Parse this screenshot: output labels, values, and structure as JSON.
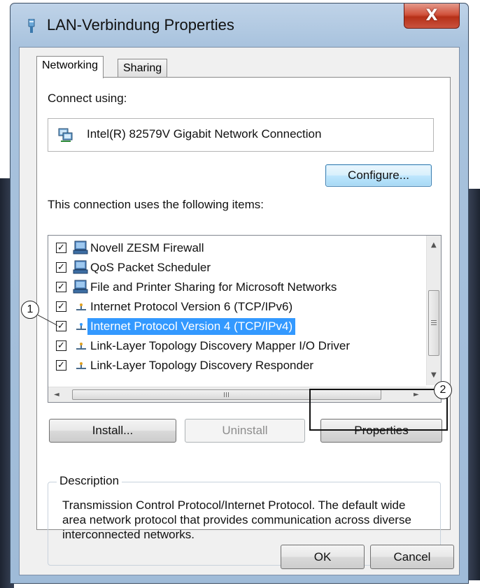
{
  "window": {
    "title": "LAN-Verbindung Properties",
    "close_glyph": "X"
  },
  "tabs": [
    {
      "label": "Networking",
      "active": true
    },
    {
      "label": "Sharing",
      "active": false
    }
  ],
  "connect_using": {
    "label": "Connect using:",
    "adapter": "Intel(R) 82579V Gigabit Network Connection",
    "adapter_icon": "network-adapter-icon",
    "configure_label": "Configure..."
  },
  "items_label": "This connection uses the following items:",
  "items": [
    {
      "label": "Novell ZESM Firewall",
      "checked": true,
      "icon": "client-computer-icon",
      "selected": false
    },
    {
      "label": "QoS Packet Scheduler",
      "checked": true,
      "icon": "client-computer-icon",
      "selected": false
    },
    {
      "label": "File and Printer Sharing for Microsoft Networks",
      "checked": true,
      "icon": "client-computer-icon",
      "selected": false
    },
    {
      "label": "Internet Protocol Version 6 (TCP/IPv6)",
      "checked": true,
      "icon": "protocol-icon",
      "selected": false
    },
    {
      "label": "Internet Protocol Version 4 (TCP/IPv4)",
      "checked": true,
      "icon": "protocol-icon",
      "selected": true
    },
    {
      "label": "Link-Layer Topology Discovery Mapper I/O Driver",
      "checked": true,
      "icon": "protocol-icon",
      "selected": false
    },
    {
      "label": "Link-Layer Topology Discovery Responder",
      "checked": true,
      "icon": "protocol-icon",
      "selected": false
    }
  ],
  "scroll": {
    "up": "▲",
    "down": "▼",
    "left": "◄",
    "right": "►",
    "hgrip": "III"
  },
  "buttons": {
    "install": "Install...",
    "uninstall": "Uninstall",
    "properties": "Properties",
    "ok": "OK",
    "cancel": "Cancel"
  },
  "description": {
    "legend": "Description",
    "text": "Transmission Control Protocol/Internet Protocol. The default wide area network protocol that provides communication across diverse interconnected networks."
  },
  "callouts": [
    "1",
    "2"
  ],
  "colors": {
    "selection": "#3399ff",
    "focus_border": "#3c7fb1",
    "close_red": "#c9533e",
    "window_frame": "#a9c3de"
  }
}
